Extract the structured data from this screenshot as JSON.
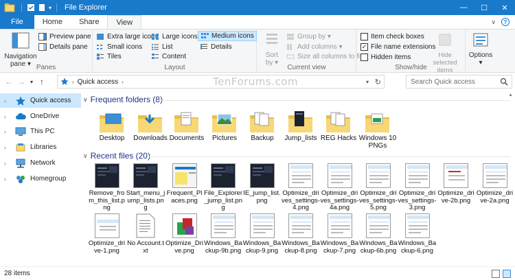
{
  "window": {
    "title": "File Explorer",
    "controls": {
      "minimize": "—",
      "maximize": "☐",
      "close": "✕"
    }
  },
  "tabs": [
    {
      "label": "File"
    },
    {
      "label": "Home"
    },
    {
      "label": "Share"
    },
    {
      "label": "View"
    }
  ],
  "ribbon": {
    "panes": {
      "label": "Panes",
      "navigation_pane": "Navigation pane ▾",
      "preview_pane": "Preview pane",
      "details_pane": "Details pane"
    },
    "layout": {
      "label": "Layout",
      "items": [
        {
          "label": "Extra large icons"
        },
        {
          "label": "Large icons"
        },
        {
          "label": "Medium icons"
        },
        {
          "label": "Small icons"
        },
        {
          "label": "List"
        },
        {
          "label": "Details"
        },
        {
          "label": "Tiles"
        },
        {
          "label": "Content"
        }
      ],
      "selected": "Medium icons"
    },
    "current_view": {
      "label": "Current view",
      "sort_by": "Sort by ▾",
      "group_by": "Group by ▾",
      "add_columns": "Add columns ▾",
      "size_columns": "Size all columns to fit"
    },
    "show_hide": {
      "label": "Show/hide",
      "item_check_boxes": {
        "label": "Item check boxes",
        "checked": false
      },
      "file_name_extensions": {
        "label": "File name extensions",
        "checked": true
      },
      "hidden_items": {
        "label": "Hidden items",
        "checked": false
      },
      "hide_selected": "Hide selected items"
    },
    "options": {
      "label": "Options",
      "dropdown": "▾"
    }
  },
  "address": {
    "path": "Quick access",
    "search_placeholder": "Search Quick access"
  },
  "watermark": "TenForums.com",
  "nav_pane": [
    {
      "label": "Quick access",
      "icon": "star-icon",
      "selected": true
    },
    {
      "label": "OneDrive",
      "icon": "cloud-icon",
      "selected": false
    },
    {
      "label": "This PC",
      "icon": "monitor-icon",
      "selected": false
    },
    {
      "label": "Libraries",
      "icon": "library-icon",
      "selected": false
    },
    {
      "label": "Network",
      "icon": "network-icon",
      "selected": false
    },
    {
      "label": "Homegroup",
      "icon": "homegroup-icon",
      "selected": false
    }
  ],
  "frequent_folders": {
    "heading": "Frequent folders (8)",
    "items": [
      {
        "label": "Desktop",
        "kind": "desktop"
      },
      {
        "label": "Downloads",
        "kind": "downloads"
      },
      {
        "label": "Documents",
        "kind": "documents"
      },
      {
        "label": "Pictures",
        "kind": "pictures"
      },
      {
        "label": "Backup",
        "kind": "folder-docs"
      },
      {
        "label": "Jump_lists",
        "kind": "folder-dark"
      },
      {
        "label": "REG Hacks",
        "kind": "folder-docs"
      },
      {
        "label": "Windows 10 PNGs",
        "kind": "folder-green"
      }
    ]
  },
  "recent_files": {
    "heading": "Recent files (20)",
    "items": [
      {
        "label": "Remove_from_this_list.png",
        "kind": "dark"
      },
      {
        "label": "Start_menu_jump_lists.png",
        "kind": "dark"
      },
      {
        "label": "Frequent_Places.png",
        "kind": "light-yellow"
      },
      {
        "label": "File_Explorer_jump_list.png",
        "kind": "dark"
      },
      {
        "label": "IE_jump_list.png",
        "kind": "dark"
      },
      {
        "label": "Optimize_drives_settings-4.png",
        "kind": "window"
      },
      {
        "label": "Optimize_drives_settings-4a.png",
        "kind": "window"
      },
      {
        "label": "Optimize_drives_settings-5.png",
        "kind": "window"
      },
      {
        "label": "Optimize_drives_settings-3.png",
        "kind": "window"
      },
      {
        "label": "Optimize_drive-2b.png",
        "kind": "window-red"
      },
      {
        "label": "Optimize_drive-2a.png",
        "kind": "window"
      },
      {
        "label": "Optimize_drive-1.png",
        "kind": "window-small"
      },
      {
        "label": "No Account.txt",
        "kind": "text"
      },
      {
        "label": "Optimize_Drive.png",
        "kind": "defrag"
      },
      {
        "label": "Windows_Backup-9b.png",
        "kind": "window"
      },
      {
        "label": "Windows_Backup-9.png",
        "kind": "window"
      },
      {
        "label": "Windows_Backup-8.png",
        "kind": "window"
      },
      {
        "label": "Windows_Backup-7.png",
        "kind": "window"
      },
      {
        "label": "Windows_Backup-6b.png",
        "kind": "window"
      },
      {
        "label": "Windows_Backup-6.png",
        "kind": "window"
      }
    ]
  },
  "status": {
    "items_count": "28 items"
  },
  "colors": {
    "accent": "#1979ca",
    "selection": "#cce8ff",
    "heading": "#1e3287",
    "folder": "#f8d775"
  }
}
